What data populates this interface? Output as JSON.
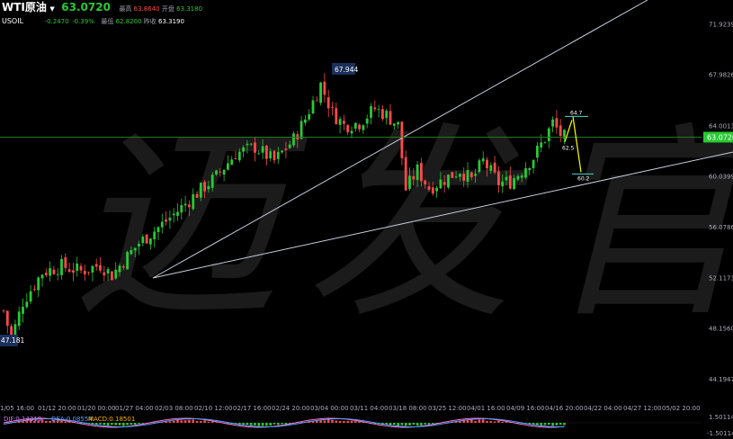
{
  "header": {
    "symbol": "WTI原油",
    "dropdown_icon": "caret-down-icon",
    "price": "63.0720",
    "code": "USOIL",
    "change": "-0.2470",
    "change_pct": "-0.39%",
    "high_label": "最高",
    "high": "63.8640",
    "low_label": "最低",
    "low": "62.8200",
    "open_label": "开盘",
    "open": "63.3180",
    "prev_label": "昨收",
    "prev": "63.3190"
  },
  "watermark": "迈发官",
  "colors": {
    "up": "#29c934",
    "down": "#ff4a4a",
    "trend": "#c8cde0",
    "annot": "#ffff00",
    "current": "#1f7a1f"
  },
  "chart_data": {
    "type": "candlestick",
    "y_ticks": [
      "71.9239",
      "67.9826",
      "64.0013",
      "60.0399",
      "56.0786",
      "52.1173",
      "48.1560",
      "44.1947"
    ],
    "x_ticks": [
      "1/05 16:00",
      "01/12 20:00",
      "01/20 00:00",
      "01/27 04:00",
      "02/03 08:00",
      "02/10 12:00",
      "02/17 16:00",
      "02/24 20:00",
      "03/04 00:00",
      "03/11 04:00",
      "03/18 08:00",
      "03/25 12:00",
      "04/01 16:00",
      "04/09 16:00",
      "04/16 20:00",
      "04/22 04:00",
      "04/27 12:00",
      "05/02 20:00"
    ],
    "ylim": [
      42.5,
      73.8
    ],
    "current_price": 63.072,
    "labels": [
      {
        "text": "67.944",
        "value": 67.944,
        "kind": "max"
      },
      {
        "text": "47.181",
        "value": 47.181,
        "kind": "min"
      },
      {
        "text": "64.7",
        "value": 64.7,
        "kind": "annot"
      },
      {
        "text": "62.5",
        "value": 62.5,
        "kind": "annot"
      },
      {
        "text": "60.2",
        "value": 60.2,
        "kind": "annot"
      }
    ],
    "close_path": [
      [
        0,
        49.5
      ],
      [
        2,
        47.3
      ],
      [
        5,
        50.2
      ],
      [
        10,
        52.5
      ],
      [
        15,
        53.0
      ],
      [
        20,
        52.6
      ],
      [
        25,
        53.1
      ],
      [
        28,
        52.3
      ],
      [
        31,
        53.4
      ],
      [
        35,
        54.8
      ],
      [
        40,
        56.0
      ],
      [
        45,
        57.3
      ],
      [
        50,
        58.7
      ],
      [
        55,
        60.0
      ],
      [
        60,
        61.8
      ],
      [
        65,
        62.3
      ],
      [
        70,
        61.2
      ],
      [
        75,
        62.9
      ],
      [
        78,
        64.5
      ],
      [
        82,
        67.2
      ],
      [
        85,
        65.0
      ],
      [
        88,
        64.0
      ],
      [
        92,
        64.2
      ],
      [
        96,
        65.3
      ],
      [
        99,
        64.8
      ],
      [
        102,
        64.0
      ],
      [
        104,
        59.0
      ],
      [
        107,
        60.5
      ],
      [
        110,
        59.1
      ],
      [
        113,
        59.6
      ],
      [
        118,
        60.5
      ],
      [
        121,
        59.7
      ],
      [
        124,
        61.2
      ],
      [
        128,
        59.5
      ],
      [
        131,
        59.6
      ],
      [
        134,
        60.5
      ],
      [
        137,
        61.5
      ],
      [
        140,
        63.0
      ],
      [
        142,
        64.2
      ],
      [
        144,
        63.3
      ],
      [
        145,
        63.07
      ]
    ],
    "macd": {
      "dif_label": "DIF:0.14319",
      "dea_label": "DEA:0.08554",
      "macd_label": "MACD:0.18501",
      "ticks": [
        "1.50114",
        "-1.50114"
      ]
    }
  }
}
